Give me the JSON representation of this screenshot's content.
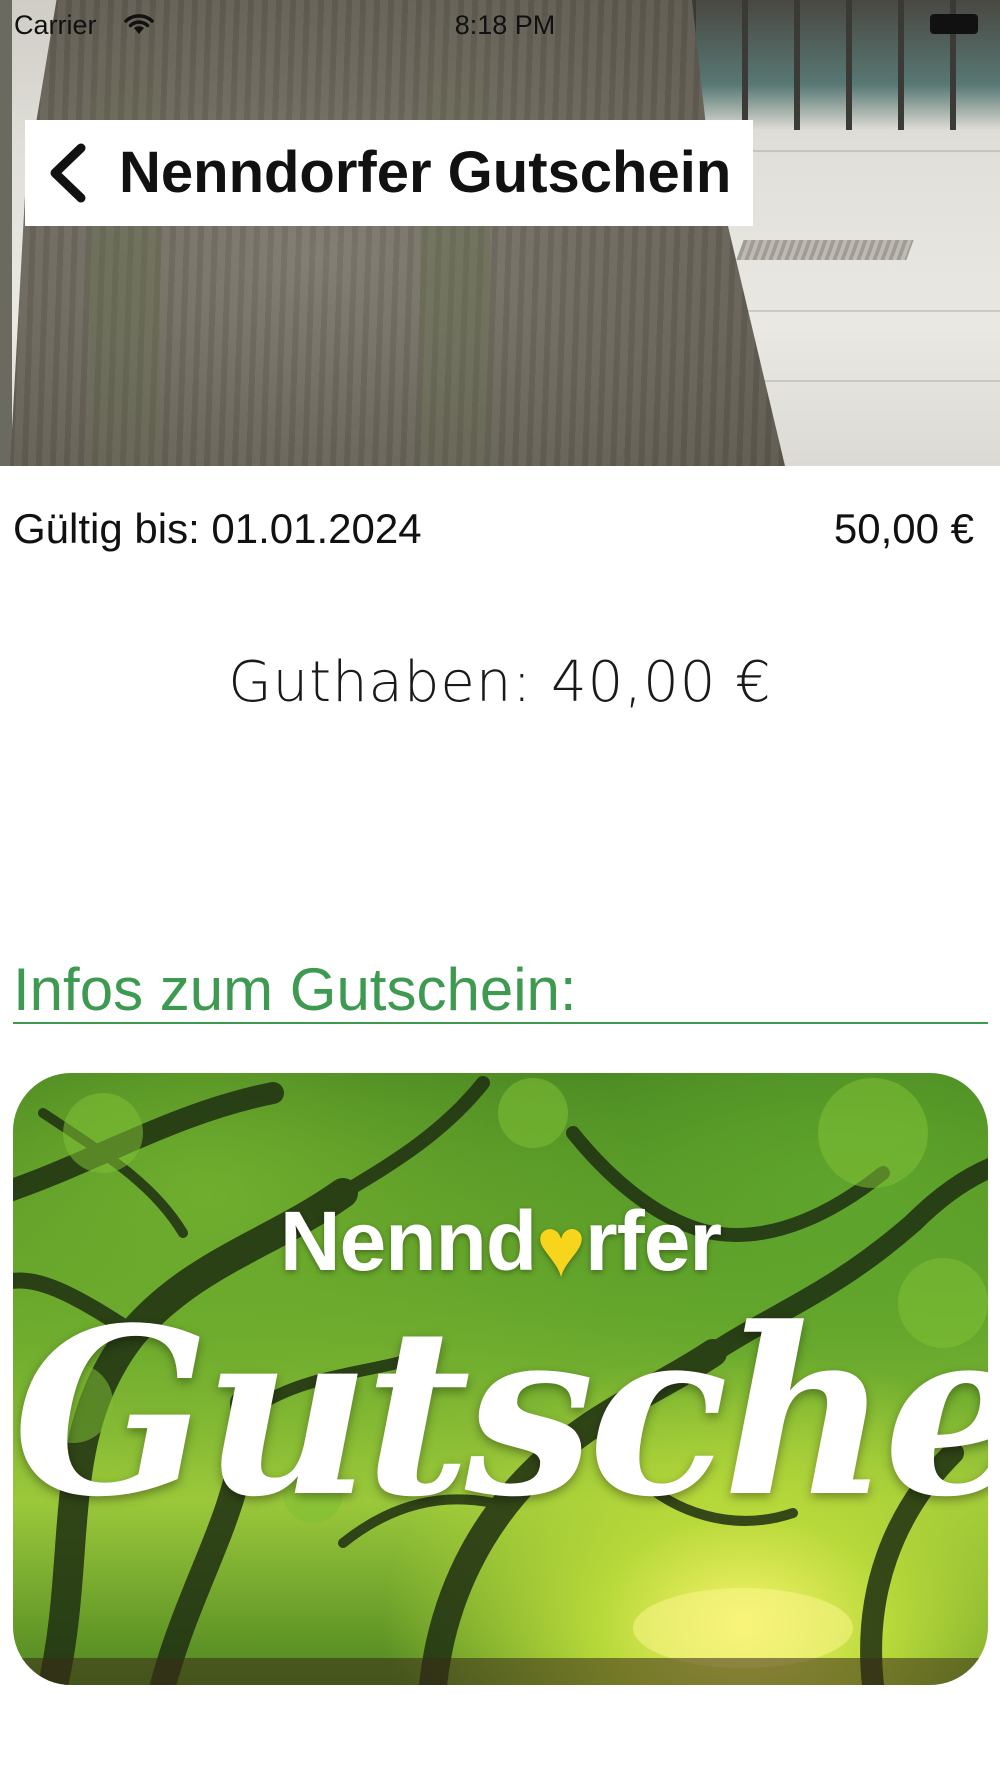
{
  "status_bar": {
    "carrier": "Carrier",
    "time": "8:18 PM",
    "wifi_icon": "wifi-icon",
    "battery_icon": "battery-icon"
  },
  "header": {
    "title": "Nenndorfer Gutschein",
    "back_icon": "chevron-left-icon"
  },
  "voucher": {
    "valid_until": "Gültig bis: 01.01.2024",
    "value": "50,00 €",
    "balance": "Guthaben: 40,00 €"
  },
  "info": {
    "heading": "Infos zum Gutschein:",
    "accent_color": "#3e9a51"
  },
  "voucher_image": {
    "brand_prefix": "Nennd",
    "brand_heart": "♥",
    "brand_suffix": "rfer",
    "script_text": "Gutschein",
    "heart_color": "#f7d51c"
  }
}
